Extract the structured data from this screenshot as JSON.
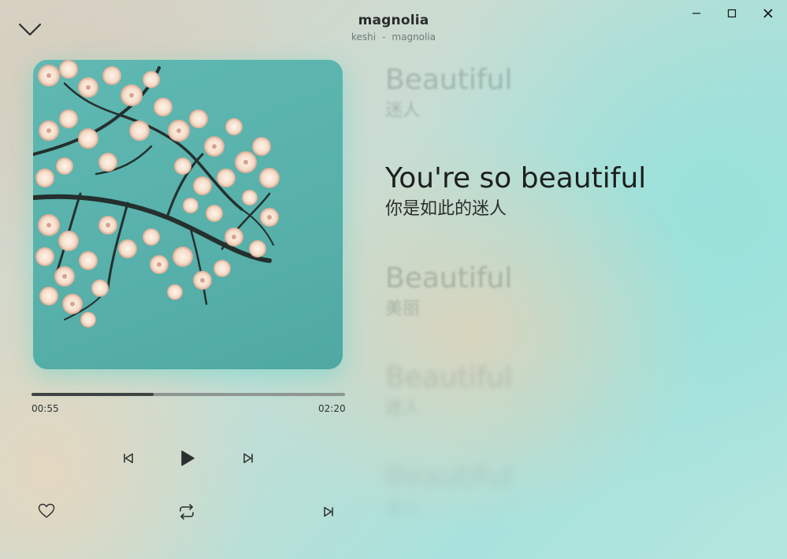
{
  "header": {
    "title": "magnolia",
    "artist": "keshi",
    "separator": "-",
    "album": "magnolia"
  },
  "window": {
    "minimize_icon": "minimize-icon",
    "maximize_icon": "maximize-icon",
    "close_icon": "close-icon"
  },
  "player": {
    "current_time": "00:55",
    "total_time": "02:20",
    "progress": 0.39
  },
  "lyrics": [
    {
      "en": "Beautiful",
      "zh": "迷人",
      "state": "previous"
    },
    {
      "en": "You're so beautiful",
      "zh": "你是如此的迷人",
      "state": "current"
    },
    {
      "en": "Beautiful",
      "zh": "美丽",
      "state": "next"
    },
    {
      "en": "Beautiful",
      "zh": "迷人",
      "state": "next"
    },
    {
      "en": "Beautiful",
      "zh": "迷人",
      "state": "next"
    }
  ],
  "colors": {
    "accent_dark": "#3e4443",
    "track": "#8e9693",
    "album_bg": "#57b0aa"
  }
}
